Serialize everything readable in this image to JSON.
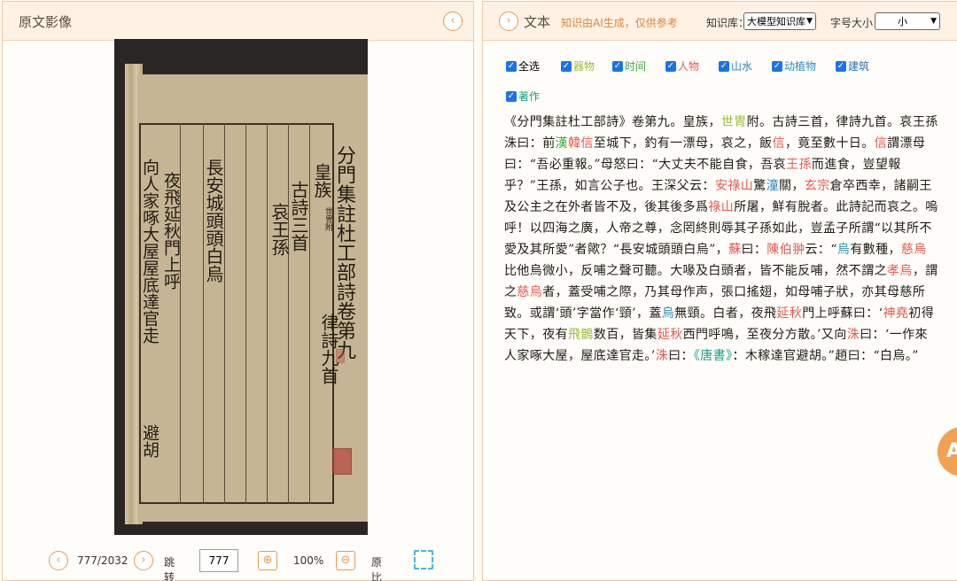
{
  "left_panel": {
    "title": "原文影像",
    "collapse_icon": "chevron-left-icon",
    "scan": {
      "col_heading": "分門集註杜工部詩卷第九",
      "col_class": "皇族",
      "col_poems": "古詩三首",
      "col_meter": "律詩九首",
      "col_title": "長安城頭頭白烏",
      "col_author": "哀王孫",
      "col_line2": "夜飛延秋門上呼",
      "col_line3": "向人家啄大屋屋底達官走",
      "col_line4": "避胡",
      "col_small": "世冑附"
    },
    "pager": {
      "count": "777/2032",
      "jump_label": "跳转到",
      "jump_value": "777",
      "zoom": "100%",
      "original_ratio": "原比例"
    }
  },
  "right_panel": {
    "title": "文本",
    "ai_note": "知识由AI生成，仅供参考",
    "kb_label": "知识库：",
    "kb_value": "大模型知识库",
    "font_label": "字号大小：",
    "font_value": "小",
    "filters": [
      {
        "label": "全选",
        "color": "#222222"
      },
      {
        "label": "器物",
        "color": "#9cbc3a"
      },
      {
        "label": "时间",
        "color": "#3faa3a"
      },
      {
        "label": "人物",
        "color": "#e8584a"
      },
      {
        "label": "山水",
        "color": "#2b83c8"
      },
      {
        "label": "动植物",
        "color": "#2c8fb7"
      },
      {
        "label": "建筑",
        "color": "#2b6fb0"
      },
      {
        "label": "著作",
        "color": "#1a9a8a"
      }
    ],
    "text_segments": [
      {
        "t": "《分門集註杜工部詩》卷第九。皇族，",
        "c": ""
      },
      {
        "t": "世冑",
        "c": "tag-object"
      },
      {
        "t": "附。古詩三首，律詩九首。哀王孫洙曰：前",
        "c": ""
      },
      {
        "t": "漢",
        "c": "tag-time"
      },
      {
        "t": "韓信",
        "c": "tag-person"
      },
      {
        "t": "至城下，釣有一漂母，哀之，飯",
        "c": ""
      },
      {
        "t": "信",
        "c": "tag-person"
      },
      {
        "t": "，竟至數十日。",
        "c": ""
      },
      {
        "t": "信",
        "c": "tag-person"
      },
      {
        "t": "謂漂母曰：“吾必重報。”母怒曰：“大丈夫不能自食，吾哀",
        "c": ""
      },
      {
        "t": "王孫",
        "c": "tag-person"
      },
      {
        "t": "而進食，豈望報乎？”王孫，如言公子也。王深父云：",
        "c": ""
      },
      {
        "t": "安祿山",
        "c": "tag-person"
      },
      {
        "t": "驚",
        "c": ""
      },
      {
        "t": "潼",
        "c": "tag-place"
      },
      {
        "t": "關，",
        "c": ""
      },
      {
        "t": "玄宗",
        "c": "tag-person"
      },
      {
        "t": "倉卒西幸，諸嗣王及公主之在外者皆不及，後其後多爲",
        "c": ""
      },
      {
        "t": "祿山",
        "c": "tag-person"
      },
      {
        "t": "所屠，鮮有脫者。此詩記而哀之。嗚呼！以四海之廣，人帝之尊，念罔終則辱其子孫如此，豈孟子所謂“以其所不愛及其所愛”者歟？“長安城頭頭白烏”，",
        "c": ""
      },
      {
        "t": "蘇",
        "c": "tag-person"
      },
      {
        "t": "曰：",
        "c": ""
      },
      {
        "t": "陳伯翀",
        "c": "tag-person"
      },
      {
        "t": "云：“",
        "c": ""
      },
      {
        "t": "烏",
        "c": "tag-animal"
      },
      {
        "t": "有數種，",
        "c": ""
      },
      {
        "t": "慈烏",
        "c": "tag-person"
      },
      {
        "t": "比他烏微小，反哺之聲可聽。大喙及白頭者，皆不能反哺，然不謂之",
        "c": ""
      },
      {
        "t": "孝烏",
        "c": "tag-person"
      },
      {
        "t": "，謂之",
        "c": ""
      },
      {
        "t": "慈烏",
        "c": "tag-person"
      },
      {
        "t": "者，蓋受哺之際，乃其母作声，張口搖翅，如母哺子狀，亦其母慈所致。或謂‘頭’字當作‘頸’，蓋",
        "c": ""
      },
      {
        "t": "烏",
        "c": "tag-animal"
      },
      {
        "t": "無頸。白者，夜飛",
        "c": ""
      },
      {
        "t": "延秋",
        "c": "tag-person"
      },
      {
        "t": "門上呼蘇曰：‘",
        "c": ""
      },
      {
        "t": "神堯",
        "c": "tag-person"
      },
      {
        "t": "初得天下，夜有",
        "c": ""
      },
      {
        "t": "飛鵲",
        "c": "tag-object"
      },
      {
        "t": "数百，皆集",
        "c": ""
      },
      {
        "t": "延秋",
        "c": "tag-person"
      },
      {
        "t": "西門呼鳴，至夜分方散。’又向",
        "c": ""
      },
      {
        "t": "洙",
        "c": "tag-person"
      },
      {
        "t": "曰：‘一作來人家啄大屋，屋底達官走。’",
        "c": ""
      },
      {
        "t": "洙",
        "c": "tag-person"
      },
      {
        "t": "曰：",
        "c": ""
      },
      {
        "t": "《唐書》",
        "c": "tag-book"
      },
      {
        "t": "：木稼達官避胡。”趙曰：“白烏。”",
        "c": ""
      }
    ],
    "float_badge": "A"
  }
}
